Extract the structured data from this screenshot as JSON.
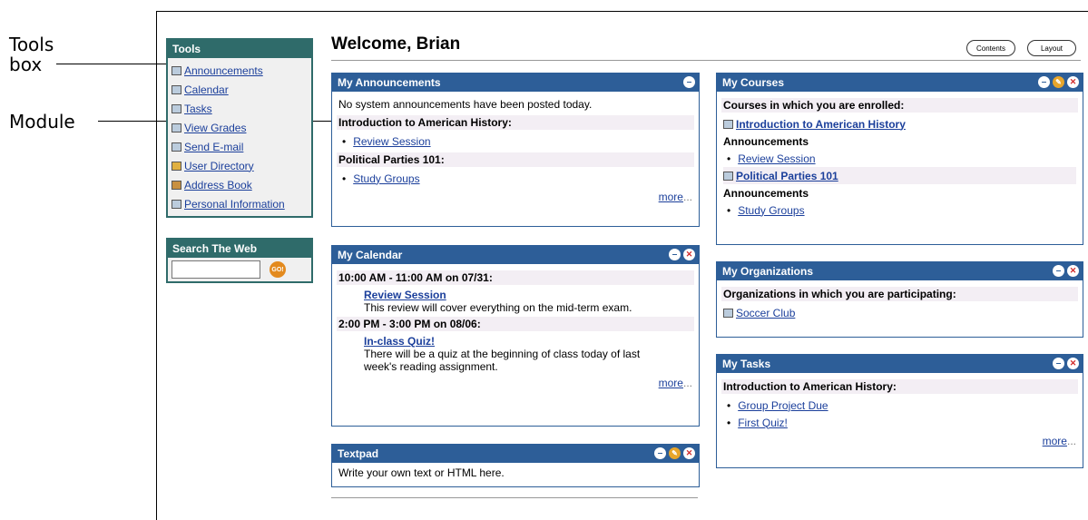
{
  "callouts": {
    "tools_box": [
      "Tools",
      "box"
    ],
    "module": "Module"
  },
  "header": {
    "welcome": "Welcome, Brian",
    "contents_btn": "Contents",
    "layout_btn": "Layout"
  },
  "tools": {
    "title": "Tools",
    "items": [
      {
        "label": "Announcements",
        "icon": "book-icon"
      },
      {
        "label": "Calendar",
        "icon": "calendar-icon"
      },
      {
        "label": "Tasks",
        "icon": "tasks-icon"
      },
      {
        "label": "View Grades",
        "icon": "grades-icon"
      },
      {
        "label": "Send E-mail",
        "icon": "email-icon"
      },
      {
        "label": "User Directory",
        "icon": "user-icon"
      },
      {
        "label": "Address Book",
        "icon": "address-book-icon"
      },
      {
        "label": "Personal Information",
        "icon": "personal-info-icon"
      }
    ]
  },
  "search": {
    "title": "Search The Web",
    "go": "GO!",
    "value": ""
  },
  "announcements": {
    "title": "My Announcements",
    "note": "No system announcements have been posted today.",
    "course1": "Introduction to American History:",
    "course1_item": "Review Session",
    "course2": "Political Parties 101:",
    "course2_item": "Study Groups",
    "more": "more",
    "more_suffix": "..."
  },
  "calendar": {
    "title": "My Calendar",
    "event1_time": "10:00 AM - 11:00 AM on 07/31:",
    "event1_title": "Review Session",
    "event1_desc": "This review will cover everything on the mid-term exam.",
    "event2_time": "2:00 PM - 3:00 PM on 08/06:",
    "event2_title": "In-class Quiz!",
    "event2_desc1": "There will be a quiz at the beginning of class today of last",
    "event2_desc2": "week's reading assignment.",
    "more": "more",
    "more_suffix": "..."
  },
  "textpad": {
    "title": "Textpad",
    "body": "Write your own text or HTML here."
  },
  "courses": {
    "title": "My Courses",
    "heading": "Courses in which you are enrolled:",
    "course1": "Introduction to American History",
    "ann_label1": "Announcements",
    "course1_item": "Review Session",
    "course2": "Political Parties 101",
    "ann_label2": "Announcements",
    "course2_item": "Study Groups"
  },
  "organizations": {
    "title": "My Organizations",
    "heading": "Organizations in which you are participating:",
    "item": "Soccer Club"
  },
  "tasks": {
    "title": "My Tasks",
    "heading": "Introduction to American History:",
    "items": [
      "Group Project Due",
      "First Quiz!"
    ],
    "more": "more",
    "more_suffix": "..."
  },
  "colors": {
    "module_header": "#2d5e98",
    "tools_header": "#2f6b6a",
    "link": "#1b3f9b"
  }
}
